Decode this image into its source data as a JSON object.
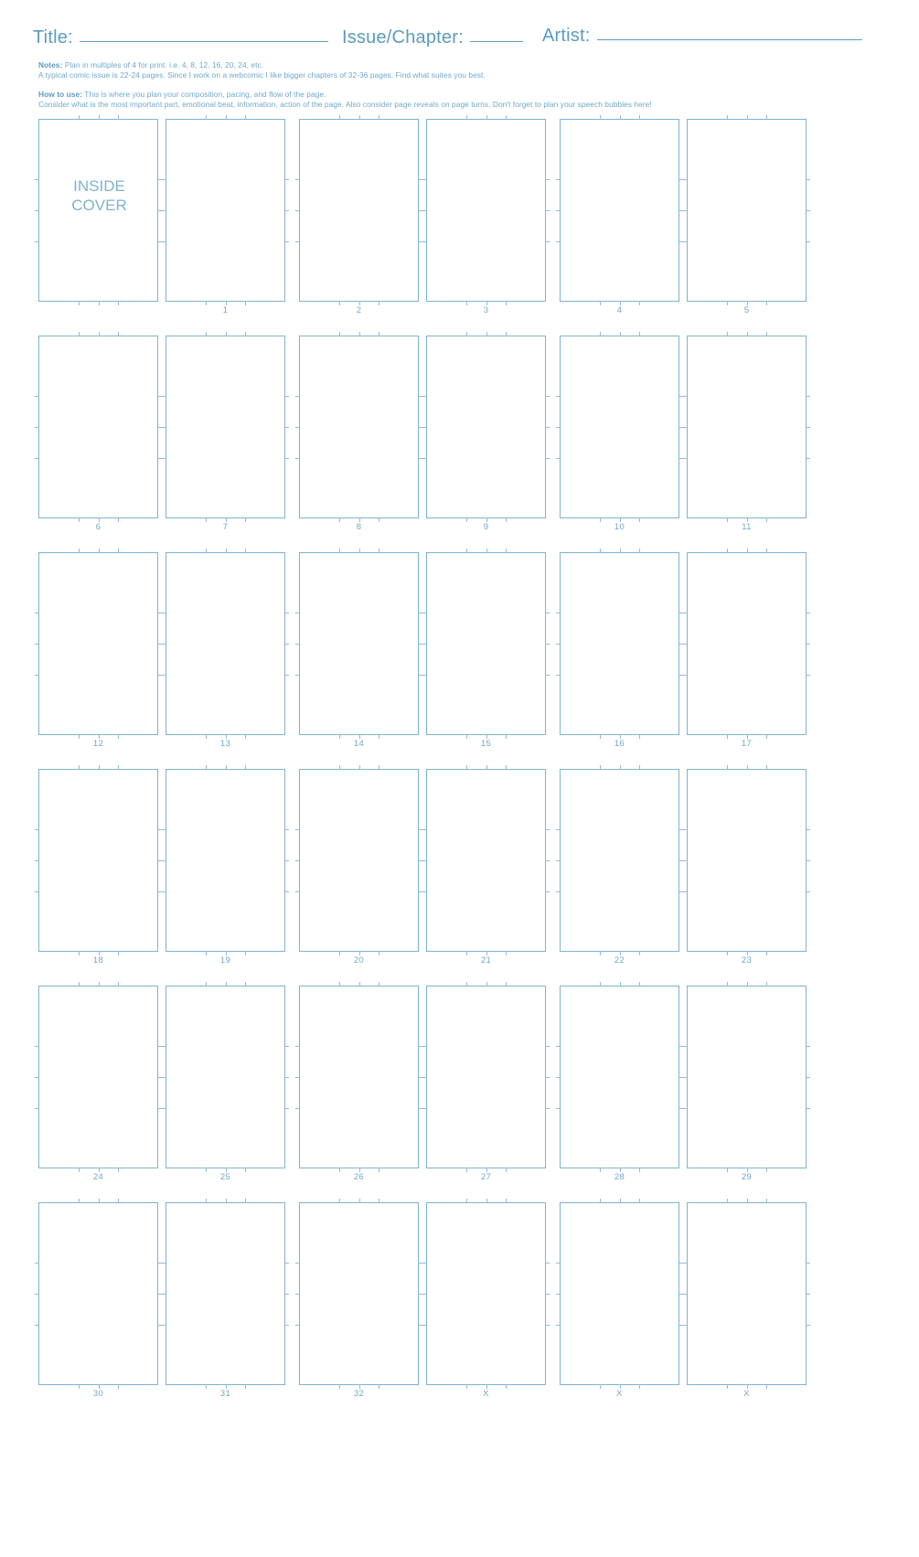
{
  "header": {
    "title_label": "Title:",
    "issue_label": "Issue/Chapter:",
    "artist_label": "Artist:"
  },
  "notes": {
    "label": "Notes:",
    "line1": " Plan in multiples of 4 for print. i.e. 4, 8, 12, 16, 20, 24, etc.",
    "line2": "A typical comic issue is 22-24 pages. Since I work on a webcomic I like bigger chapters of 32-36 pages. Find what suites you best."
  },
  "howto": {
    "label": "How to use:",
    "line1": " This is where you plan your composition, pacing, and flow of the page.",
    "line2": "Consider what is the most important part, emotional beat, information, action of the page. Also consider page reveals on page turns. Don't forget to plan your speech bubbles here!"
  },
  "inside_cover_text": "INSIDE\nCOVER",
  "colors": {
    "line": "#7fb3d0",
    "text": "#6fa9cb",
    "accent": "#5b9cc0"
  },
  "grid": {
    "rows": [
      {
        "spreads": [
          {
            "cells": [
              {
                "label": "",
                "inside_cover": true
              },
              {
                "label": "1"
              }
            ]
          },
          {
            "cells": [
              {
                "label": "2"
              },
              {
                "label": "3"
              }
            ]
          },
          {
            "cells": [
              {
                "label": "4"
              },
              {
                "label": "5"
              }
            ]
          }
        ]
      },
      {
        "spreads": [
          {
            "cells": [
              {
                "label": "6"
              },
              {
                "label": "7"
              }
            ]
          },
          {
            "cells": [
              {
                "label": "8"
              },
              {
                "label": "9"
              }
            ]
          },
          {
            "cells": [
              {
                "label": "10"
              },
              {
                "label": "11"
              }
            ]
          }
        ]
      },
      {
        "spreads": [
          {
            "cells": [
              {
                "label": "12"
              },
              {
                "label": "13"
              }
            ]
          },
          {
            "cells": [
              {
                "label": "14"
              },
              {
                "label": "15"
              }
            ]
          },
          {
            "cells": [
              {
                "label": "16"
              },
              {
                "label": "17"
              }
            ]
          }
        ]
      },
      {
        "spreads": [
          {
            "cells": [
              {
                "label": "18"
              },
              {
                "label": "19"
              }
            ]
          },
          {
            "cells": [
              {
                "label": "20"
              },
              {
                "label": "21"
              }
            ]
          },
          {
            "cells": [
              {
                "label": "22"
              },
              {
                "label": "23"
              }
            ]
          }
        ]
      },
      {
        "spreads": [
          {
            "cells": [
              {
                "label": "24"
              },
              {
                "label": "25"
              }
            ]
          },
          {
            "cells": [
              {
                "label": "26"
              },
              {
                "label": "27"
              }
            ]
          },
          {
            "cells": [
              {
                "label": "28"
              },
              {
                "label": "29"
              }
            ]
          }
        ]
      },
      {
        "spreads": [
          {
            "cells": [
              {
                "label": "30"
              },
              {
                "label": "31"
              }
            ]
          },
          {
            "cells": [
              {
                "label": "32"
              },
              {
                "label": "X"
              }
            ]
          },
          {
            "cells": [
              {
                "label": "X"
              },
              {
                "label": "X"
              }
            ]
          }
        ]
      }
    ]
  }
}
